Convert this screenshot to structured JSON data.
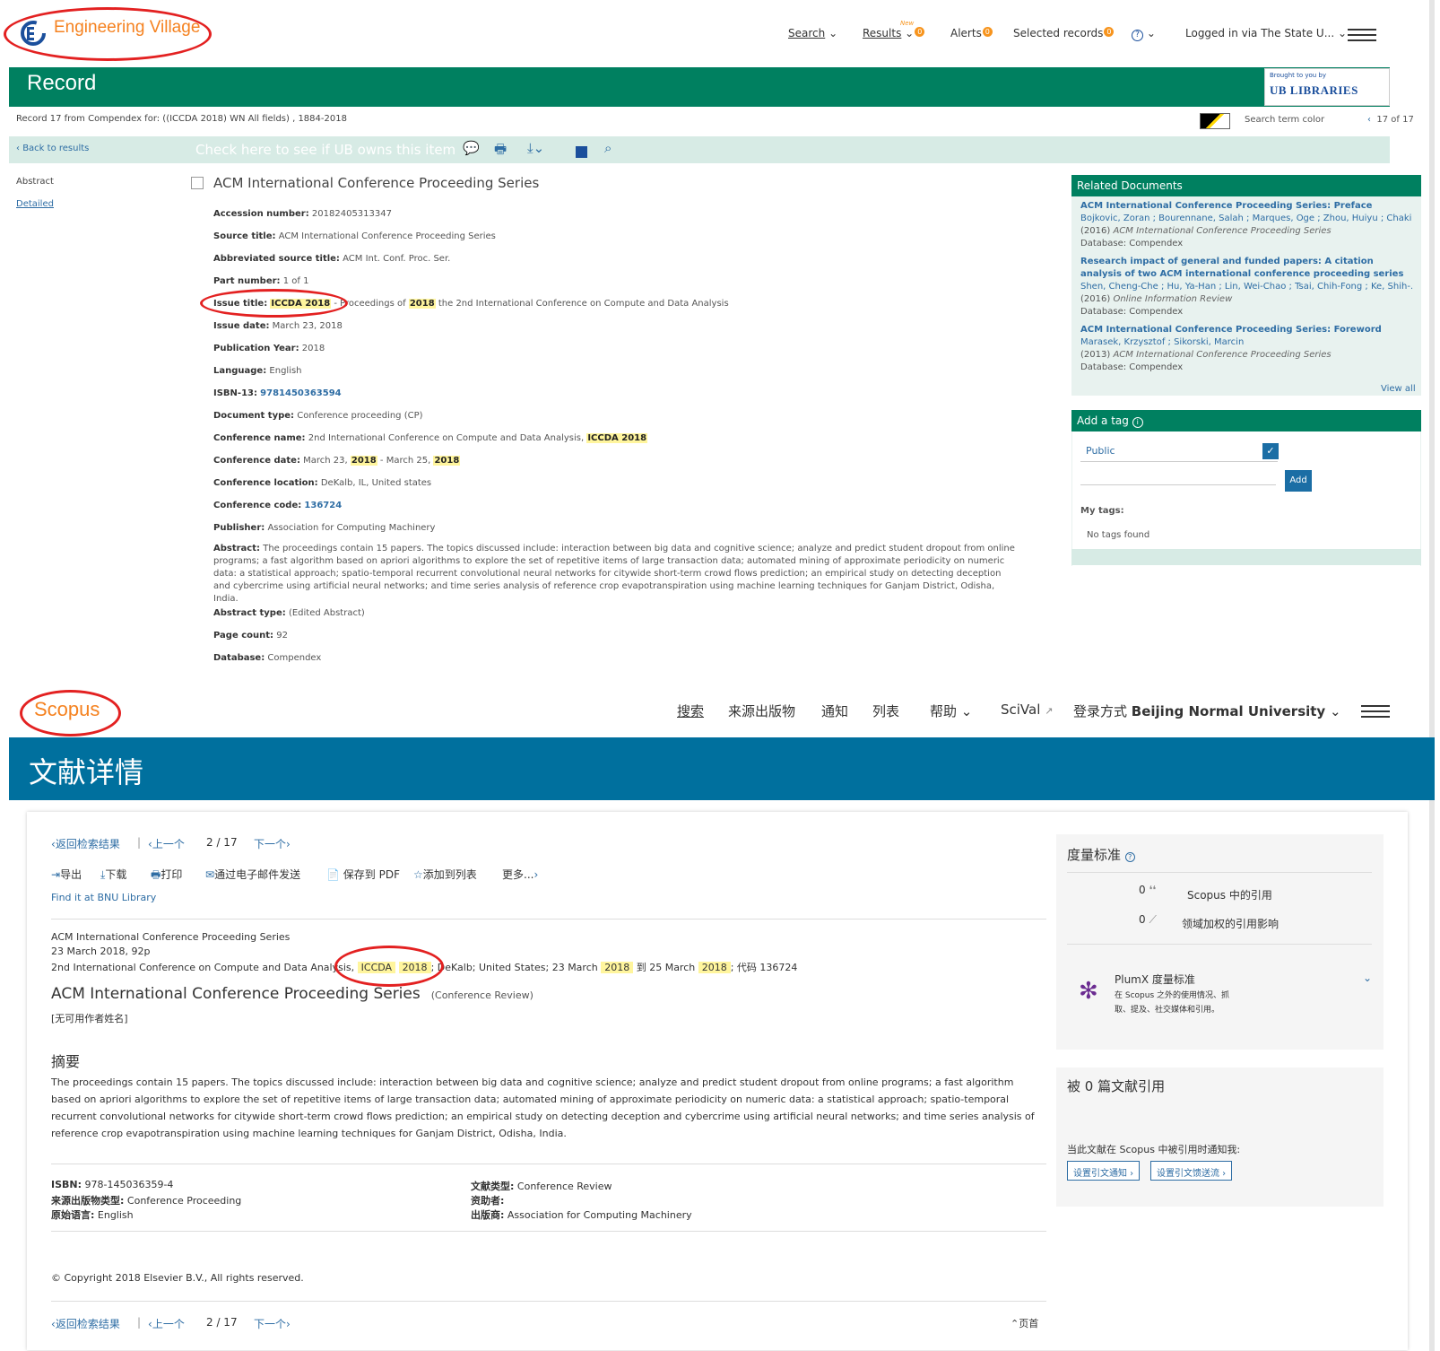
{
  "ev": {
    "logo_text": "Engineering Village",
    "nav": {
      "search": "Search",
      "results": "Results",
      "results_new": "New",
      "results_badge": "0",
      "alerts": "Alerts",
      "alerts_badge": "0",
      "selected": "Selected records",
      "selected_badge": "0",
      "help": "?",
      "login": "Logged in via The State U..."
    },
    "banner_title": "Record",
    "brought_by": "Brought to you by",
    "libraries": "UB LIBRARIES",
    "record_info": "Record 17 from Compendex for: ((ICCDA 2018) WN All fields) , 1884-2018",
    "search_term_color": "Search term color",
    "pager": "17 of 17",
    "back_to_results": "Back to results",
    "check_ub": "Check here to see if UB owns this item",
    "side": {
      "abstract": "Abstract",
      "detailed": "Detailed"
    },
    "title": "ACM International Conference Proceeding Series",
    "fields": {
      "accession_label": "Accession number:",
      "accession_value": "20182405313347",
      "source_label": "Source title:",
      "source_value": "ACM International Conference Proceeding Series",
      "abbr_label": "Abbreviated source title:",
      "abbr_value": "ACM Int. Conf. Proc. Ser.",
      "part_label": "Part number:",
      "part_value": "1 of 1",
      "issue_label": "Issue title:",
      "issue_hl1": "ICCDA 2018",
      "issue_mid": " - Proceedings of ",
      "issue_hl2": "2018",
      "issue_rest": " the 2nd International Conference on Compute and Data Analysis",
      "issue_date_label": "Issue date:",
      "issue_date_value": "March 23, 2018",
      "pubyear_label": "Publication Year:",
      "pubyear_value": "2018",
      "lang_label": "Language:",
      "lang_value": "English",
      "isbn_label": "ISBN-13:",
      "isbn_value": "9781450363594",
      "doctype_label": "Document type:",
      "doctype_value": "Conference proceeding (CP)",
      "confname_label": "Conference name:",
      "confname_value": "2nd International Conference on Compute and Data Analysis, ",
      "confname_hl": "ICCDA 2018",
      "confdate_label": "Conference date:",
      "confdate_a": "March 23, ",
      "confdate_hl1": "2018",
      "confdate_b": " - March 25, ",
      "confdate_hl2": "2018",
      "confloc_label": "Conference location:",
      "confloc_value": "DeKalb, IL, United states",
      "confcode_label": "Conference code:",
      "confcode_value": "136724",
      "publisher_label": "Publisher:",
      "publisher_value": "Association for Computing Machinery",
      "abstract_label": "Abstract:",
      "abstract_value": "The proceedings contain 15 papers. The topics discussed include: interaction between big data and cognitive science; analyze and predict student dropout from online programs; a fast algorithm based on apriori algorithms to explore the set of repetitive items of large transaction data; automated mining of approximate periodicity on numeric data: a statistical approach; spatio-temporal recurrent convolutional neural networks for citywide short-term crowd flows prediction; an empirical study on detecting deception and cybercrime using artificial neural networks; and time series analysis of reference crop evapotranspiration using machine learning techniques for Ganjam District, Odisha, India.",
      "abstype_label": "Abstract type:",
      "abstype_value": "(Edited Abstract)",
      "pagecount_label": "Page count:",
      "pagecount_value": "92",
      "db_label": "Database:",
      "db_value": "Compendex"
    },
    "related": {
      "title": "Related Documents",
      "items": [
        {
          "title": "ACM International Conference Proceeding Series: Preface",
          "authors": "Bojkovic, Zoran ; Bourennane, Salah ; Marques, Oge ; Zhou, Huiyu ; Chaki, ...",
          "year": "(2016)",
          "source": "ACM International Conference Proceeding Series",
          "db": "Database: Compendex"
        },
        {
          "title": "Research impact of general and funded papers: A citation analysis of two ACM international conference proceeding series",
          "authors": "Shen, Cheng-Che ; Hu, Ya-Han ; Lin, Wei-Chao ; Tsai, Chih-Fong ; Ke, Shih-...",
          "year": "(2016)",
          "source": "Online Information Review",
          "db": "Database: Compendex"
        },
        {
          "title": "ACM International Conference Proceeding Series: Foreword",
          "authors": "Marasek, Krzysztof ; Sikorski, Marcin",
          "year": "(2013)",
          "source": "ACM International Conference Proceeding Series",
          "db": "Database: Compendex"
        }
      ],
      "view_all": "View all"
    },
    "tag": {
      "title": "Add a tag",
      "select": "Public",
      "add": "Add",
      "my_tags": "My tags:",
      "none": "No tags found"
    }
  },
  "sc": {
    "logo": "Scopus",
    "nav": {
      "search": "搜索",
      "sources": "来源出版物",
      "alerts": "通知",
      "lists": "列表",
      "help": "帮助",
      "scival": "SciVal",
      "login_prefix": "登录方式",
      "login_inst": "Beijing Normal University"
    },
    "banner_title": "文献详情",
    "navrow": {
      "back": "返回检索结果",
      "prev": "上一个",
      "page": "2 / 17",
      "next": "下一个"
    },
    "actions": {
      "export": "导出",
      "download": "下载",
      "print": "打印",
      "email": "通过电子邮件发送",
      "pdf": "保存到 PDF",
      "addlist": "添加到列表",
      "more": "更多..."
    },
    "find_it": "Find it at BNU Library",
    "source_line1": "ACM International Conference Proceeding Series",
    "source_line2": "23 March 2018, 92p",
    "conf_a": "2nd International Conference on Compute and Data Analysis, ",
    "conf_hl1": "ICCDA",
    "conf_hl2": "2018",
    "conf_b": "; DeKalb; United States; 23 March ",
    "conf_hl3": "2018",
    "conf_c": " 到 25 March ",
    "conf_hl4": "2018",
    "conf_d": "; 代码 136724",
    "title": "ACM International Conference Proceeding Series",
    "doc_kind": "(Conference Review)",
    "no_author": "[无可用作者姓名]",
    "abs_heading": "摘要",
    "abstract": "The proceedings contain 15 papers. The topics discussed include: interaction between big data and cognitive science; analyze and predict student dropout from online programs; a fast algorithm based on apriori algorithms to explore the set of repetitive items of large transaction data; automated mining of approximate periodicity on numeric data: a statistical approach; spatio-temporal recurrent convolutional networks for citywide short-term crowd flows prediction; an empirical study on detecting deception and cybercrime using artificial neural networks; and time series analysis of reference crop evapotranspiration using machine learning techniques for Ganjam District, Odisha, India.",
    "meta": {
      "isbn_label": "ISBN:",
      "isbn_value": "978-145036359-4",
      "srctype_label": "来源出版物类型:",
      "srctype_value": "Conference Proceeding",
      "lang_label": "原始语言:",
      "lang_value": "English",
      "doctype_label": "文献类型:",
      "doctype_value": "Conference Review",
      "sponsor_label": "资助者:",
      "publisher_label": "出版商:",
      "publisher_value": "Association for Computing Machinery"
    },
    "copyright": "© Copyright 2018 Elsevier B.V., All rights reserved.",
    "top": "页首",
    "metrics": {
      "title": "度量标准",
      "cites_value": "0",
      "cites_label": "Scopus 中的引用",
      "fwci_value": "0",
      "fwci_label": "领域加权的引用影响",
      "plumx_title": "PlumX 度量标准",
      "plumx_desc": "在 Scopus 之外的使用情况、抓取、提及、社交媒体和引用。"
    },
    "cited": {
      "title": "被 0 篇文献引用",
      "note": "当此文献在 Scopus 中被引用时通知我:",
      "btn1": "设置引文通知",
      "btn2": "设置引文馈送流"
    }
  }
}
